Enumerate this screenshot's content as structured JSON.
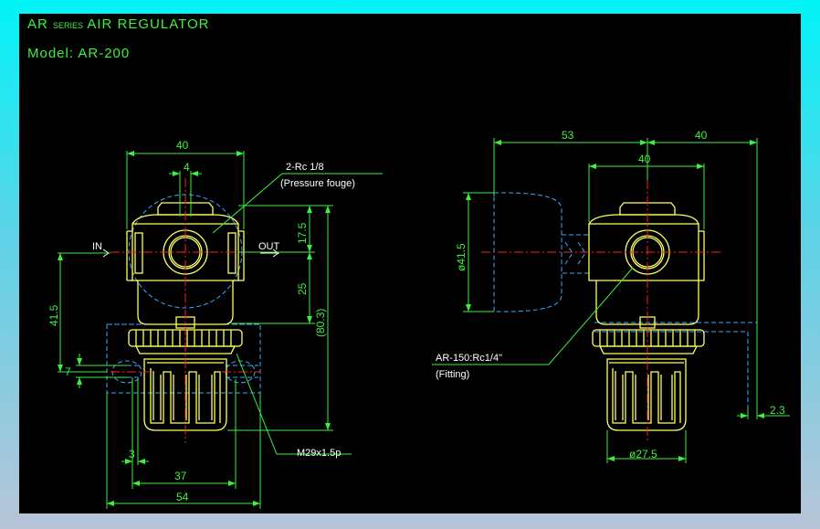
{
  "title": {
    "series_prefix": "AR",
    "series_small": "SERIES",
    "series_rest": "AIR REGULATOR",
    "model_line": "Model: AR-200"
  },
  "left_view": {
    "width_top": "40",
    "port_spacing": "4",
    "gauge_port_label": "2-Rc 1/8",
    "gauge_port_sub": "(Pressure fouge)",
    "in_label": "IN",
    "out_label": "OUT",
    "dim_17_5": "17.5",
    "dim_25": "25",
    "dim_80_3": "(80.3)",
    "dim_41_5": "41.5",
    "dim_7": "7",
    "dim_3": "3",
    "dim_37": "37",
    "dim_54": "54",
    "thread_label": "M29x1.5p"
  },
  "right_view": {
    "dim_53": "53",
    "dim_40_outer": "40",
    "dim_40_inner": "40",
    "gauge_dia": "ø41.5",
    "fitting_label": "AR-150:Rc1/4\"",
    "fitting_sub": "(Fitting)",
    "knob_dia": "ø27.5",
    "dim_2_3": "2.3"
  },
  "colors": {
    "background": "#000000",
    "dimension": "#3ef03e",
    "body_outline": "#ffff66",
    "hidden_lines": "#3aa9ff",
    "centerline": "#ff2020",
    "frame": "#00f4f8"
  }
}
